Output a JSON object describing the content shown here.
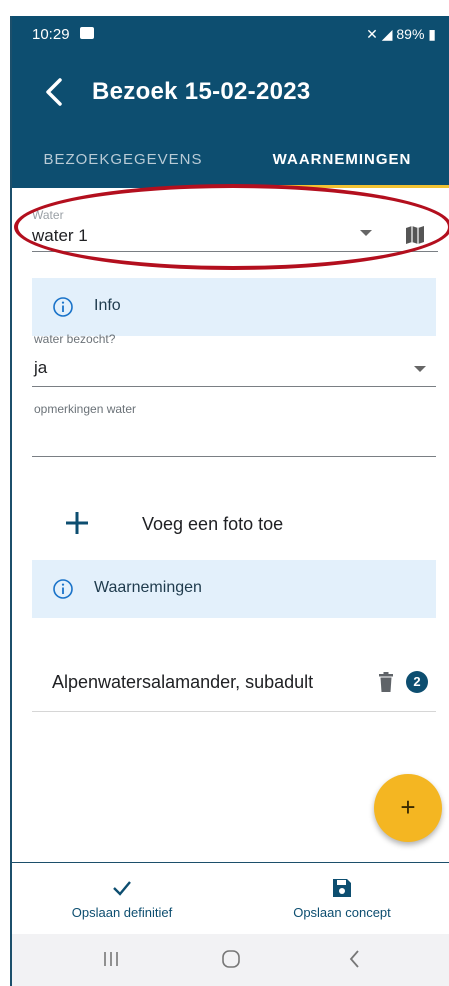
{
  "statusbar": {
    "time": "10:29",
    "right_text": "89%"
  },
  "appbar": {
    "title": "Bezoek 15-02-2023"
  },
  "tabs": [
    {
      "label": "BEZOEKGEGEVENS"
    },
    {
      "label": "WAARNEMINGEN"
    }
  ],
  "form": {
    "water": {
      "label": "Water",
      "value": "water 1"
    },
    "info_label": "Info",
    "water_bezocht": {
      "label": "water bezocht?",
      "value": "ja"
    },
    "opmerkingen": {
      "label": "opmerkingen water",
      "value": ""
    },
    "add_photo_label": "Voeg een foto toe",
    "waarnemingen_label": "Waarnemingen"
  },
  "observations": [
    {
      "name": "Alpenwatersalamander, subadult",
      "count": "2"
    }
  ],
  "bottombar": {
    "save_final_label": "Opslaan definitief",
    "save_concept_label": "Opslaan concept"
  },
  "colors": {
    "primary": "#0d4e70",
    "accent": "#f4b622",
    "info_bg": "#e3f0fb",
    "highlight": "#b30f1e"
  },
  "icons": {
    "back": "arrow-left-icon",
    "map": "map-icon",
    "info": "info-circle-icon",
    "add": "plus-icon",
    "delete": "trash-icon",
    "save_final": "check-icon",
    "save_concept": "floppy-disk-icon"
  }
}
